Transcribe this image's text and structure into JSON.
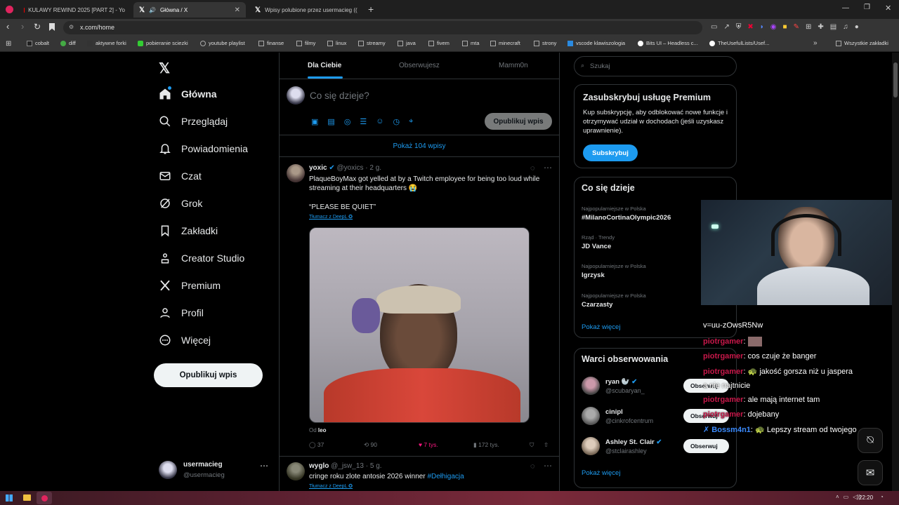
{
  "browser": {
    "tabs": [
      {
        "title": "KULAWY REWIND 2025 [PART 2] - Yo"
      },
      {
        "title": "Główna / X"
      },
      {
        "title": "Wpisy polubione przez usermacieg (("
      }
    ],
    "url": "x.com/home",
    "bookmarks": [
      "cobalt",
      "diff",
      "aktywne forki",
      "pobieranie sciezki",
      "youtube playlist",
      "finanse",
      "filmy",
      "linux",
      "streamy",
      "java",
      "fivem",
      "mta",
      "minecraft",
      "strony",
      "vscode klawiszologia",
      "Bits UI – Headless c...",
      "TheUsefulLists/Usef...",
      "Wszystkie zakładki"
    ]
  },
  "sidebar": {
    "items": [
      {
        "label": "Główna",
        "icon": "home-icon"
      },
      {
        "label": "Przeglądaj",
        "icon": "search-icon"
      },
      {
        "label": "Powiadomienia",
        "icon": "bell-icon"
      },
      {
        "label": "Czat",
        "icon": "mail-icon"
      },
      {
        "label": "Grok",
        "icon": "grok-icon"
      },
      {
        "label": "Zakładki",
        "icon": "bookmark-icon"
      },
      {
        "label": "Creator Studio",
        "icon": "creator-icon"
      },
      {
        "label": "Premium",
        "icon": "x-icon"
      },
      {
        "label": "Profil",
        "icon": "person-icon"
      },
      {
        "label": "Więcej",
        "icon": "more-circle-icon"
      }
    ],
    "post_button": "Opublikuj wpis",
    "account": {
      "name": "usermacieg",
      "handle": "@usermacieg"
    }
  },
  "feed": {
    "tabs": [
      "Dla Ciebie",
      "Obserwujesz",
      "Mamm0n"
    ],
    "composer_placeholder": "Co się dzieje?",
    "composer_button": "Opublikuj wpis",
    "show_new": "Pokaż 104 wpisy",
    "posts": [
      {
        "name": "yoxic",
        "meta": "@yoxics · 2 g.",
        "text": "PlaqueBoyMax got yelled at by a Twitch employee for being too loud while streaming at their headquarters 😭",
        "text2": "“PLEASE BE QUIET”",
        "translate": "Tłumacz z DeepL",
        "from_prefix": "Od",
        "from": "leo",
        "replies": "37",
        "reposts": "90",
        "likes": "7 tys.",
        "views": "172 tys."
      },
      {
        "name": "wyglo",
        "meta": "@_jsw_13 · 5 g.",
        "text": "cringe roku zlote antosie 2026 winner",
        "hashtag": "#Dełhigacja",
        "translate": "Tłumacz z DeepL"
      }
    ]
  },
  "right": {
    "search_placeholder": "Szukaj",
    "premium": {
      "title": "Zasubskrybuj usługę Premium",
      "body": "Kup subskrypcję, aby odblokować nowe funkcje i otrzymywać udział w dochodach (jeśli uzyskasz uprawnienie).",
      "button": "Subskrybuj"
    },
    "trends": {
      "title": "Co się dzieje",
      "items": [
        {
          "cat": "Najpopularniejsze w Polska",
          "name": "#MilanoCortinaOlympic2026"
        },
        {
          "cat": "Rząd · Trendy",
          "name": "JD Vance"
        },
        {
          "cat": "Najpopularniejsze w Polska",
          "name": "Igrzysk"
        },
        {
          "cat": "Najpopularniejsze w Polska",
          "name": "Czarzasty"
        }
      ],
      "more": "Pokaż więcej"
    },
    "follow": {
      "title": "Warci obserwowania",
      "items": [
        {
          "name": "ryan 🦭",
          "handle": "@scubaryan_",
          "button": "Obserwuj"
        },
        {
          "name": "cinipl",
          "handle": "@cinkrofcentrum",
          "button": "Obserwuj"
        },
        {
          "name": "Ashley St. Clair",
          "handle": "@stclairashley",
          "button": "Obserwuj"
        }
      ],
      "more": "Pokaż więcej"
    }
  },
  "chat": [
    {
      "user": "",
      "text": "v=uu-zOwsR5Nw"
    },
    {
      "user": "piotrgamer",
      "text": ""
    },
    {
      "user": "piotrgamer",
      "text": "cos czuje że banger"
    },
    {
      "user": "piotrgamer",
      "text": "jakość gorsza niż u jaspera"
    },
    {
      "user": "",
      "text": "a nie najtnicie"
    },
    {
      "user": "piotrgamer",
      "text": "ale mają internet tam"
    },
    {
      "user": "piotrgamer",
      "text": "dojebany"
    },
    {
      "user": "Bossm4n1",
      "text": "Lepszy stream od twojego"
    }
  ],
  "taskbar": {
    "time": "22:20"
  }
}
